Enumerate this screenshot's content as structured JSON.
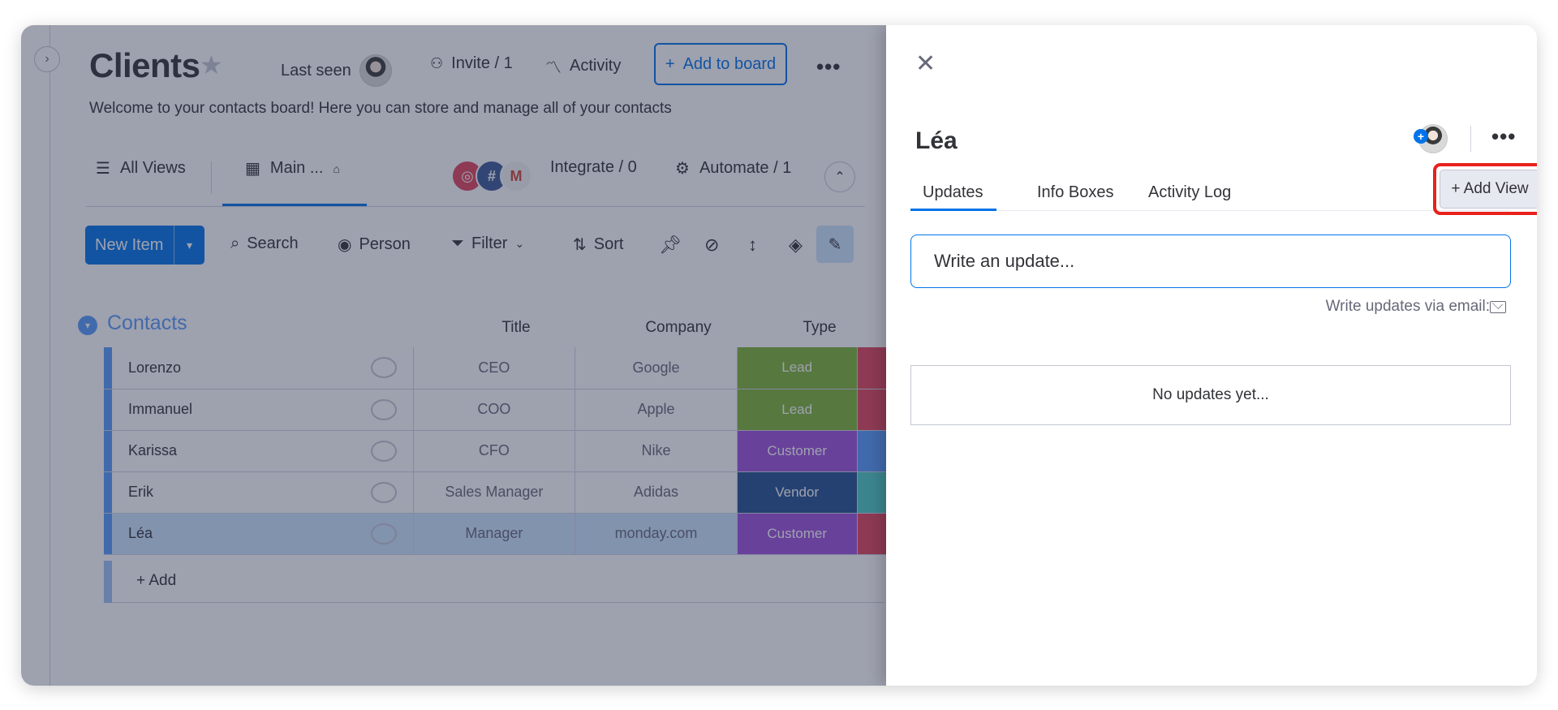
{
  "board": {
    "title": "Clients",
    "description": "Welcome to your contacts board! Here you can store and manage all of your contacts",
    "header": {
      "last_seen_label": "Last seen",
      "invite_label": "Invite / 1",
      "activity_label": "Activity",
      "add_to_board_label": "Add to board"
    },
    "views": {
      "all_views_label": "All Views",
      "main_view_label": "Main ...",
      "integrate_label": "Integrate / 0",
      "automate_label": "Automate / 1"
    },
    "toolbar": {
      "new_item_label": "New Item",
      "search_label": "Search",
      "person_label": "Person",
      "filter_label": "Filter",
      "sort_label": "Sort"
    },
    "group": {
      "title": "Contacts",
      "columns": [
        "Title",
        "Company",
        "Type"
      ],
      "rows": [
        {
          "name": "Lorenzo",
          "title": "CEO",
          "company": "Google",
          "type": "Lead",
          "type_color": "#7fb535",
          "next_color": "#e2445c"
        },
        {
          "name": "Immanuel",
          "title": "COO",
          "company": "Apple",
          "type": "Lead",
          "type_color": "#7fb535",
          "next_color": "#e2445c"
        },
        {
          "name": "Karissa",
          "title": "CFO",
          "company": "Nike",
          "type": "Customer",
          "type_color": "#9d50dd",
          "next_color": "#579bfc"
        },
        {
          "name": "Erik",
          "title": "Sales Manager",
          "company": "Adidas",
          "type": "Vendor",
          "type_color": "#225091",
          "next_color": "#4eccc6"
        },
        {
          "name": "Léa",
          "title": "Manager",
          "company": "monday.com",
          "type": "Customer",
          "type_color": "#9d50dd",
          "next_color": "#e2445c"
        }
      ],
      "add_label": "+ Add"
    }
  },
  "panel": {
    "item_name": "Léa",
    "tabs": [
      "Updates",
      "Info Boxes",
      "Activity Log"
    ],
    "add_view_label": "+ Add View",
    "update_placeholder": "Write an update...",
    "email_hint": "Write updates via email:",
    "empty_state": "No updates yet..."
  },
  "colors": {
    "primary": "#0073ea",
    "highlight": "#e8211d",
    "group": "#579bfc"
  }
}
